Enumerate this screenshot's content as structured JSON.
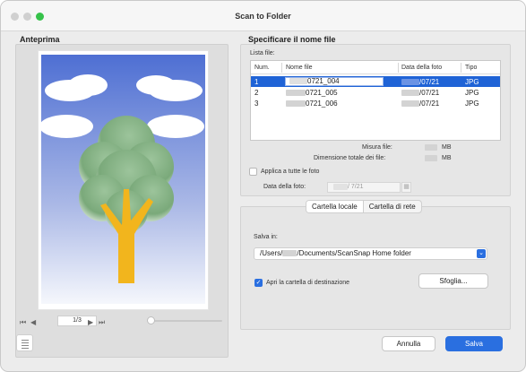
{
  "window": {
    "title": "Scan to Folder"
  },
  "preview": {
    "title": "Anteprima",
    "page_indicator": "1/3",
    "first_glyph": "⏮",
    "prev_glyph": "◀",
    "next_glyph": "▶",
    "last_glyph": "⏭"
  },
  "file_name": {
    "title": "Specificare il nome file",
    "list_label": "Lista file:",
    "columns": [
      "Num.",
      "Nome file",
      "Data della foto",
      "Tipo"
    ],
    "rows": [
      {
        "num": "1",
        "name": "0721_004",
        "date": "/07/21",
        "type": "JPG",
        "selected": true
      },
      {
        "num": "2",
        "name": "0721_005",
        "date": "/07/21",
        "type": "JPG",
        "selected": false
      },
      {
        "num": "3",
        "name": "0721_006",
        "date": "/07/21",
        "type": "JPG",
        "selected": false
      }
    ],
    "size_label": "Misura file:",
    "total_label": "Dimensione totale dei file:",
    "size_unit": "MB",
    "total_unit": "MB",
    "apply_all_label": "Applica a tutte le foto",
    "photo_date_label": "Data della foto:",
    "photo_date_value": "/ 7/21"
  },
  "destination": {
    "tabs": [
      "Cartella locale",
      "Cartella di rete"
    ],
    "active_tab": 0,
    "save_in_label": "Salva in:",
    "path_prefix": "/Users/",
    "path_suffix": "/Documents/ScanSnap Home folder",
    "open_folder_label": "Apri la cartella di destinazione",
    "open_folder_checked": true,
    "browse_label": "Sfoglia..."
  },
  "footer": {
    "cancel_label": "Annulla",
    "save_label": "Salva"
  },
  "colors": {
    "accent": "#2a6fe0",
    "selection": "#1f63d6",
    "sky": "#5a7ad6",
    "tree": "#7fb07f",
    "trunk": "#f2b51d"
  }
}
